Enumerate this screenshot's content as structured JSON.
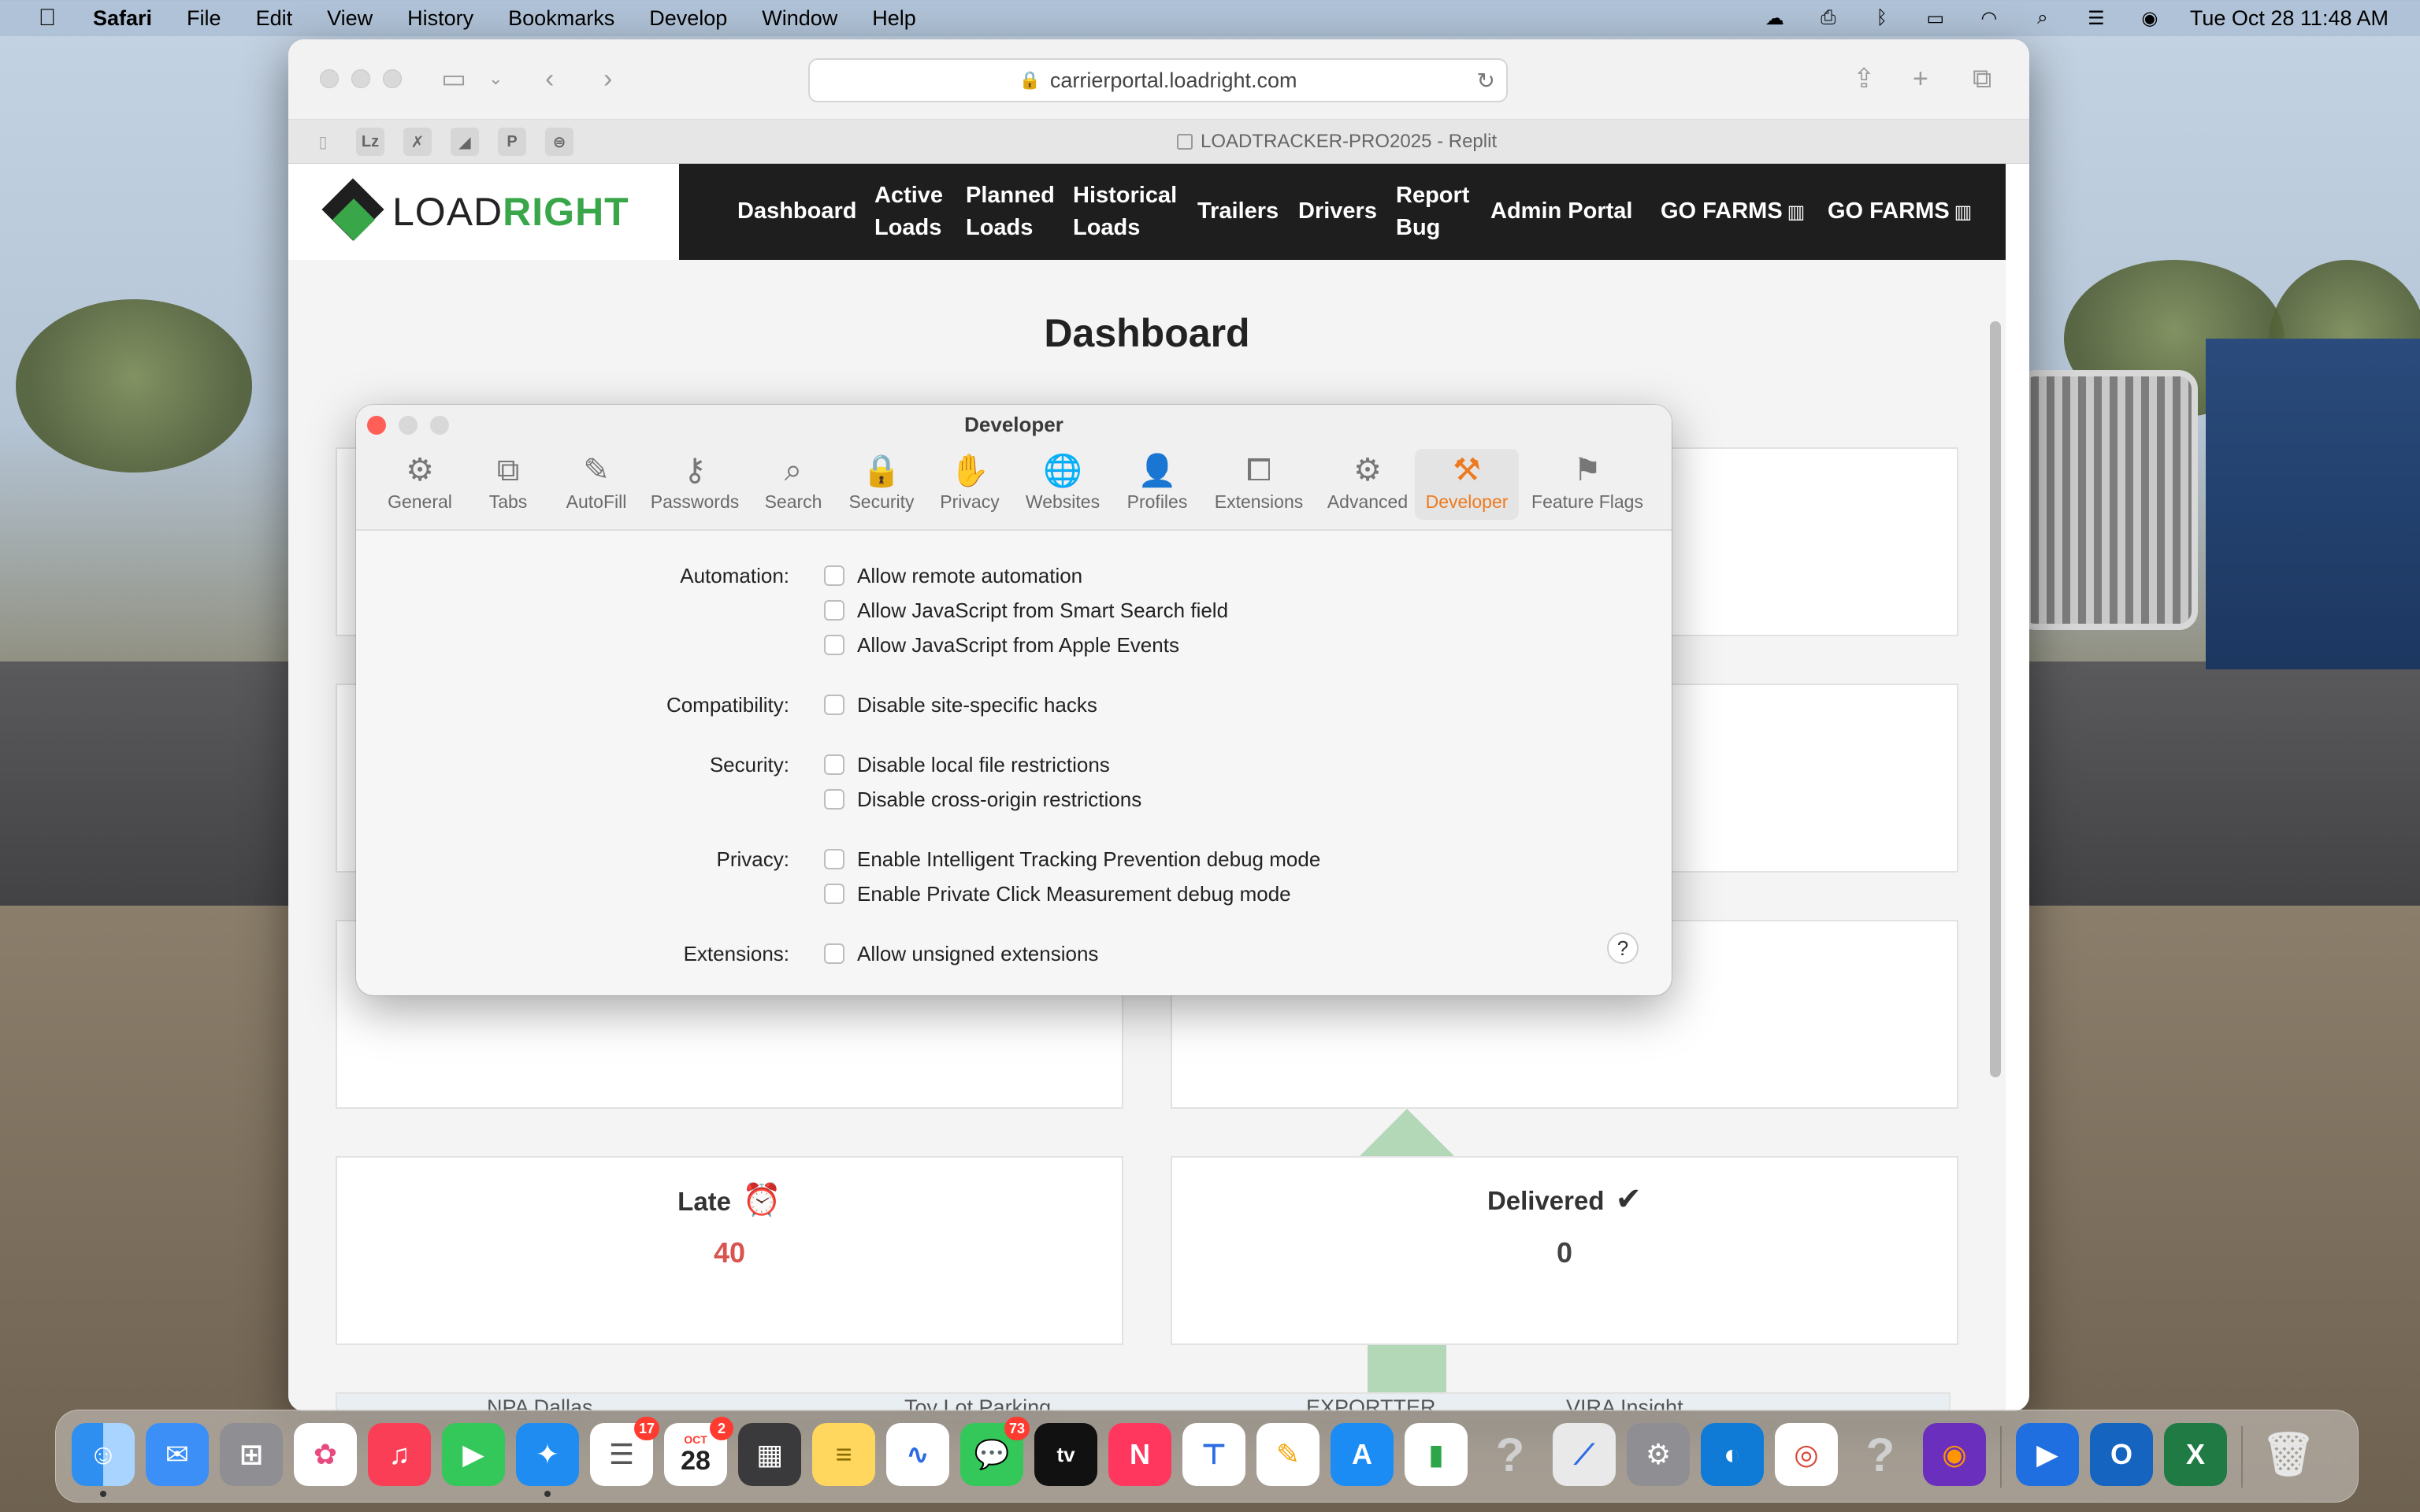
{
  "menubar": {
    "app": "Safari",
    "items": [
      "File",
      "Edit",
      "View",
      "History",
      "Bookmarks",
      "Develop",
      "Window",
      "Help"
    ],
    "clock": "Tue Oct 28  11:48 AM"
  },
  "browser": {
    "url": "carrierportal.loadright.com",
    "tab_title": "LOADTRACKER-PRO2025 - Replit",
    "favorites": [
      "Lz",
      "✗",
      "◢",
      "P",
      "⊜"
    ]
  },
  "site": {
    "logo_left": "LOAD",
    "logo_right": "RIGHT",
    "nav": [
      "Dashboard",
      "Active Loads",
      "Planned Loads",
      "Historical Loads",
      "Trailers",
      "Drivers",
      "Report Bug",
      "Admin Portal",
      "GO FARMS",
      "GO FARMS"
    ],
    "page_title": "Dashboard",
    "cards": {
      "late": {
        "label": "Late",
        "value": "40",
        "color": "#d9534f"
      },
      "delivered": {
        "label": "Delivered",
        "value": "0",
        "color": "#444444"
      }
    },
    "map_labels": [
      "NPA Dallas",
      "Toy Lot Parking",
      "EXPORTTER",
      "VIRA Insight"
    ]
  },
  "prefs": {
    "title": "Developer",
    "tabs": [
      "General",
      "Tabs",
      "AutoFill",
      "Passwords",
      "Search",
      "Security",
      "Privacy",
      "Websites",
      "Profiles",
      "Extensions",
      "Advanced",
      "Developer",
      "Feature Flags"
    ],
    "active_tab": "Developer",
    "accent": "#ee7a1f",
    "sections": {
      "automation": {
        "label": "Automation:",
        "options": [
          "Allow remote automation",
          "Allow JavaScript from Smart Search field",
          "Allow JavaScript from Apple Events"
        ]
      },
      "compatibility": {
        "label": "Compatibility:",
        "options": [
          "Disable site-specific hacks"
        ]
      },
      "security": {
        "label": "Security:",
        "options": [
          "Disable local file restrictions",
          "Disable cross-origin restrictions"
        ]
      },
      "privacy": {
        "label": "Privacy:",
        "options": [
          "Enable Intelligent Tracking Prevention debug mode",
          "Enable Private Click Measurement debug mode"
        ]
      },
      "extensions": {
        "label": "Extensions:",
        "options": [
          "Allow unsigned extensions"
        ]
      }
    },
    "help": "?"
  },
  "dock": {
    "reminders_badge": "17",
    "calendar_badge": "2",
    "calendar_month": "OCT",
    "calendar_day": "28",
    "messages_badge": "73"
  }
}
